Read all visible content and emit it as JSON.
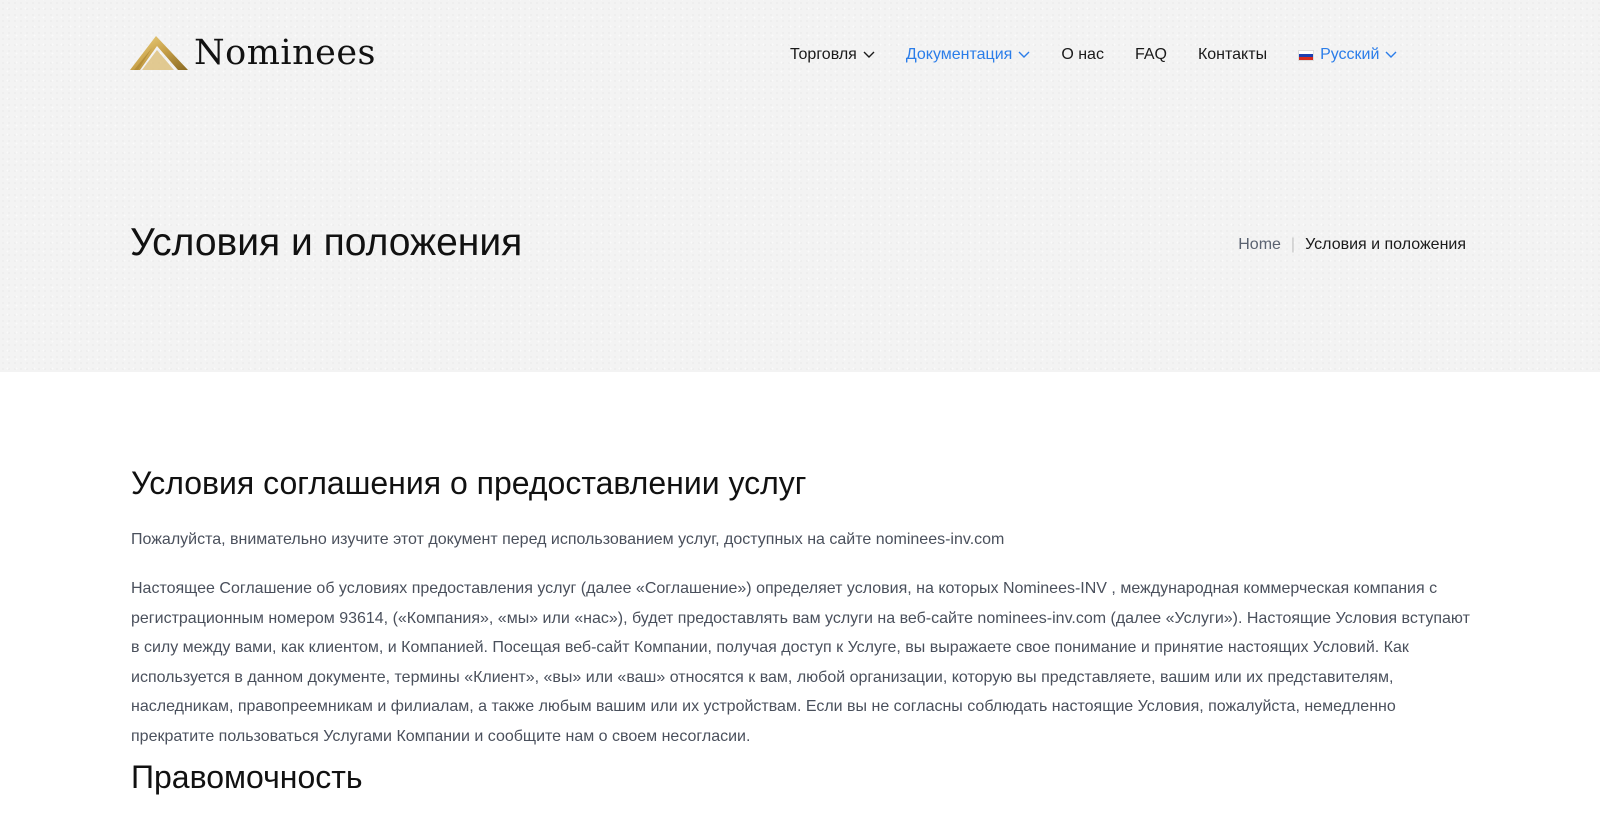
{
  "brand": {
    "name": "Nominees"
  },
  "nav": {
    "items": [
      {
        "label": "Торговля",
        "dropdown": true,
        "active": false
      },
      {
        "label": "Документация",
        "dropdown": true,
        "active": true
      },
      {
        "label": "О нас",
        "dropdown": false,
        "active": false
      },
      {
        "label": "FAQ",
        "dropdown": false,
        "active": false
      },
      {
        "label": "Контакты",
        "dropdown": false,
        "active": false
      }
    ],
    "language": {
      "label": "Русский",
      "flag": "russia-flag-icon"
    }
  },
  "hero": {
    "title": "Условия и положения",
    "breadcrumb": {
      "home": "Home",
      "separator": "|",
      "current": "Условия и положения"
    }
  },
  "content": {
    "heading": "Условия соглашения о предоставлении услуг",
    "lead": "Пожалуйста, внимательно изучите этот документ перед использованием услуг, доступных на сайте nominees-inv.com",
    "paragraph": "Настоящее Соглашение об условиях предоставления услуг (далее «Соглашение») определяет условия, на которых Nominees-INV , международная коммерческая компания с регистрационным номером 93614, («Компания», «мы» или «нас»), будет предоставлять вам услуги на веб-сайте nominees-inv.com (далее «Услуги»). Настоящие Условия вступают в силу между вами, как клиентом, и Компанией. Посещая веб-сайт Компании, получая доступ к Услуге, вы выражаете свое понимание и принятие настоящих Условий. Как используется в данном документе, термины «Клиент», «вы» или «ваш» относятся к вам, любой организации, которую вы представляете, вашим или их представителям, наследникам, правопреемникам и филиалам, а также любым вашим или их устройствам. Если вы не согласны соблюдать настоящие Условия, пожалуйста, немедленно прекратите пользоваться Услугами Компании и сообщите нам о своем несогласии.",
    "next_heading": "Правомочность"
  },
  "colors": {
    "accent": "#2b7de9",
    "text": "#1a1a1a",
    "muted": "#4a505c",
    "hero_bg": "#f3f3f3",
    "logo_gold": "#c9a24a"
  }
}
